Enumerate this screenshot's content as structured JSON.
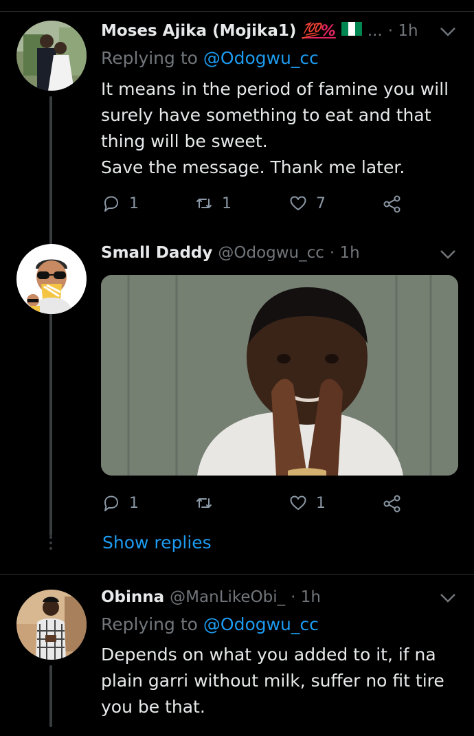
{
  "tweets": [
    {
      "name": "Moses Ajika (Mojika1)",
      "name_suffix": "💯%",
      "ellipsis": "...",
      "time": "· 1h",
      "replying_prefix": "Replying to ",
      "replying_handle": "@Odogwu_cc",
      "lines": [
        "It means in the period of famine you will",
        "surely have something to eat and that",
        "thing will be sweet.",
        "Save the message. Thank me later."
      ],
      "replies": "1",
      "retweets": "1",
      "likes": "7"
    },
    {
      "name": "Small Daddy",
      "handle": "@Odogwu_cc",
      "time": "· 1h",
      "replies": "1",
      "retweets": "",
      "likes": "1",
      "show_replies": "Show replies"
    },
    {
      "name": "Obinna",
      "handle": "@ManLikeObi_",
      "time": "· 1h",
      "replying_prefix": "Replying to ",
      "replying_handle": "@Odogwu_cc",
      "lines": [
        "Depends on what you added to it, if na",
        "plain garri without milk, suffer no fit tire",
        "you be that."
      ]
    }
  ],
  "colors": {
    "background": "#000000",
    "text": "#e7e9ea",
    "muted": "#71767b",
    "link": "#1d9bf0",
    "flag_green": "#008751"
  },
  "icons": [
    "reply-icon",
    "retweet-icon",
    "like-icon",
    "share-icon",
    "chevron-down-icon"
  ]
}
